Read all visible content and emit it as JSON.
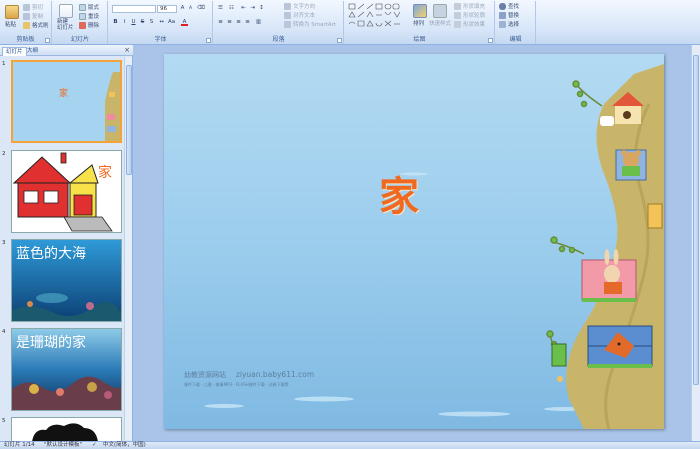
{
  "ribbon": {
    "clipboard": {
      "label": "剪贴板",
      "paste": "粘贴",
      "cut": "剪切",
      "copy": "复制",
      "format_painter": "格式刷"
    },
    "slides": {
      "label": "幻灯片",
      "new_slide": "新建\n幻灯片",
      "layout": "版式",
      "reset": "重设",
      "delete": "删除"
    },
    "font": {
      "label": "字体",
      "font_name": "",
      "font_size": "96"
    },
    "paragraph": {
      "label": "段落",
      "text_direction": "文字方向",
      "align_text": "对齐文本",
      "convert_smartart": "转换为 SmartArt"
    },
    "drawing": {
      "label": "绘图",
      "arrange": "排列",
      "quick_styles": "快速样式",
      "shape_fill": "形状填充",
      "shape_outline": "形状轮廓",
      "shape_effects": "形状效果"
    },
    "editing": {
      "label": "编辑",
      "find": "查找",
      "replace": "替换",
      "select": "选择"
    }
  },
  "panel": {
    "tab_slides": "幻灯片",
    "tab_outline": "大纲",
    "close": "×",
    "thumbs": [
      {
        "num": "1",
        "text": "家"
      },
      {
        "num": "2",
        "text": "家"
      },
      {
        "num": "3",
        "text": "蓝色的大海"
      },
      {
        "num": "4",
        "text": "是珊瑚的家"
      },
      {
        "num": "5",
        "text": ""
      }
    ]
  },
  "slide": {
    "title": "家",
    "watermark_cn": "幼教资源网站",
    "watermark_url": "ziyuan.baby611.com",
    "watermark_sub": "课件下载 · 儿歌 · 故事MP3 · FLASH课件下载 · 试卷下载等"
  },
  "status": {
    "slide_info": "幻灯片 1/14",
    "theme": "\"默认设计模板\"",
    "language": "中文(简体，中国)"
  },
  "colors": {
    "ribbon_bg": "#d6e5f8",
    "title_orange": "#ef6a1f",
    "slide_bg": "#9fd0ef",
    "tree": "#c9b56a",
    "selection": "#f2a33a"
  }
}
